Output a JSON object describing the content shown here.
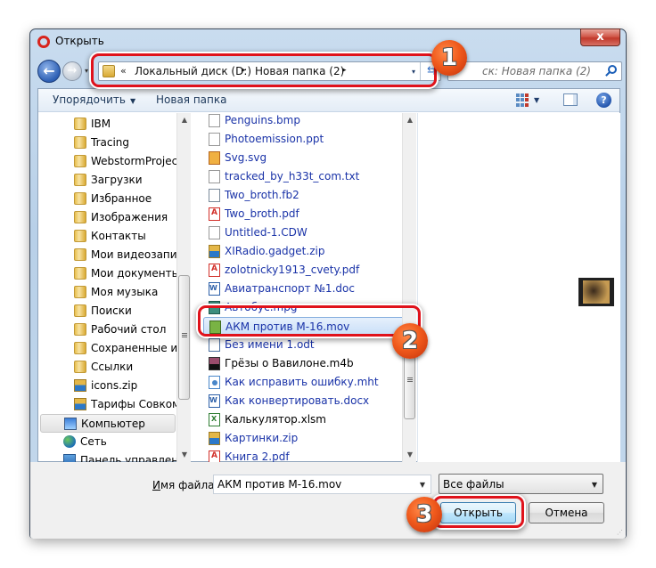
{
  "window": {
    "title": "Открыть",
    "close_glyph": "x"
  },
  "nav": {
    "back_glyph": "←",
    "forward_glyph": "→",
    "history_dropdown_glyph": "▾",
    "address": {
      "overflow_glyph": "«",
      "crumbs": [
        "Локальный диск (D:)",
        "Новая папка (2)"
      ],
      "separator_glyph": "▸",
      "dropdown_glyph": "▾",
      "refresh_glyph": "⇆"
    },
    "search": {
      "placeholder": "Поиск: Новая папка (2)",
      "visible_text": "ск: Новая папка (2)"
    }
  },
  "toolbar": {
    "organize_label": "Упорядочить",
    "organize_caret": "▼",
    "new_folder_label": "Новая папка",
    "view_dropdown_glyph": "▼",
    "help_glyph": "?"
  },
  "sidebar": {
    "scroll_up_glyph": "▲",
    "scroll_down_glyph": "▼",
    "items": [
      {
        "label": "IBM",
        "icon": "folder-icon"
      },
      {
        "label": "Tracing",
        "icon": "folder-icon"
      },
      {
        "label": "WebstormProject",
        "icon": "folder-icon"
      },
      {
        "label": "Загрузки",
        "icon": "downloads-folder-icon"
      },
      {
        "label": "Избранное",
        "icon": "favorites-folder-icon"
      },
      {
        "label": "Изображения",
        "icon": "pictures-folder-icon"
      },
      {
        "label": "Контакты",
        "icon": "contacts-folder-icon"
      },
      {
        "label": "Мои видеозаписи",
        "icon": "videos-folder-icon"
      },
      {
        "label": "Мои документы",
        "icon": "documents-folder-icon"
      },
      {
        "label": "Моя музыка",
        "icon": "music-folder-icon"
      },
      {
        "label": "Поиски",
        "icon": "searches-folder-icon"
      },
      {
        "label": "Рабочий стол",
        "icon": "desktop-folder-icon"
      },
      {
        "label": "Сохраненные игры",
        "icon": "saved-games-folder-icon"
      },
      {
        "label": "Ссылки",
        "icon": "links-folder-icon"
      },
      {
        "label": "icons.zip",
        "icon": "zip-icon"
      },
      {
        "label": "Тарифы Совкомбанк",
        "icon": "zip-icon"
      },
      {
        "label": "Компьютер",
        "icon": "computer-icon",
        "selected": true
      },
      {
        "label": "Сеть",
        "icon": "network-icon"
      },
      {
        "label": "Панель управления",
        "icon": "control-panel-icon"
      }
    ]
  },
  "files": {
    "scroll_up_glyph": "▲",
    "scroll_down_glyph": "▼",
    "items": [
      {
        "name": "Penguins.bmp",
        "icon": "generic-file-icon"
      },
      {
        "name": "Photoemission.ppt",
        "icon": "generic-file-icon"
      },
      {
        "name": "Svg.svg",
        "icon": "svg-file-icon"
      },
      {
        "name": "tracked_by_h33t_com.txt",
        "icon": "text-file-icon"
      },
      {
        "name": "Two_broth.fb2",
        "icon": "fb2-file-icon"
      },
      {
        "name": "Two_broth.pdf",
        "icon": "pdf-file-icon"
      },
      {
        "name": "Untitled-1.CDW",
        "icon": "generic-file-icon"
      },
      {
        "name": "XIRadio.gadget.zip",
        "icon": "zip-icon"
      },
      {
        "name": "zolotnicky1913_cvety.pdf",
        "icon": "pdf-file-icon"
      },
      {
        "name": "Авиатранспорт №1.doc",
        "icon": "word-file-icon"
      },
      {
        "name": "Автобус.mpg",
        "icon": "mpg-file-icon"
      },
      {
        "name": "АКМ против М-16.mov",
        "icon": "mov-file-icon",
        "selected": true
      },
      {
        "name": "Без имени 1.odt",
        "icon": "odt-file-icon"
      },
      {
        "name": "Грёзы о Вавилоне.m4b",
        "icon": "m4b-file-icon",
        "black": true
      },
      {
        "name": "Как исправить ошибку.mht",
        "icon": "mht-file-icon"
      },
      {
        "name": "Как конвертировать.docx",
        "icon": "word-file-icon"
      },
      {
        "name": "Калькулятор.xlsm",
        "icon": "excel-file-icon",
        "black": true
      },
      {
        "name": "Картинки.zip",
        "icon": "zip-icon"
      },
      {
        "name": "Книга 2.pdf",
        "icon": "pdf-file-icon"
      }
    ]
  },
  "bottom": {
    "filename_label_accel": "И",
    "filename_label_rest": "мя файла:",
    "filename_value": "АКМ против М-16.mov",
    "filename_dropdown_glyph": "▼",
    "filetype_value": "Все файлы",
    "filetype_dropdown_glyph": "▼",
    "open_label": "Открыть",
    "cancel_label": "Отмена",
    "grip_glyph": "⋰"
  },
  "annotations": {
    "step1": "1",
    "step2": "2",
    "step3": "3",
    "highlight_color": "#e0121b",
    "badge_color": "#f05a1c"
  }
}
